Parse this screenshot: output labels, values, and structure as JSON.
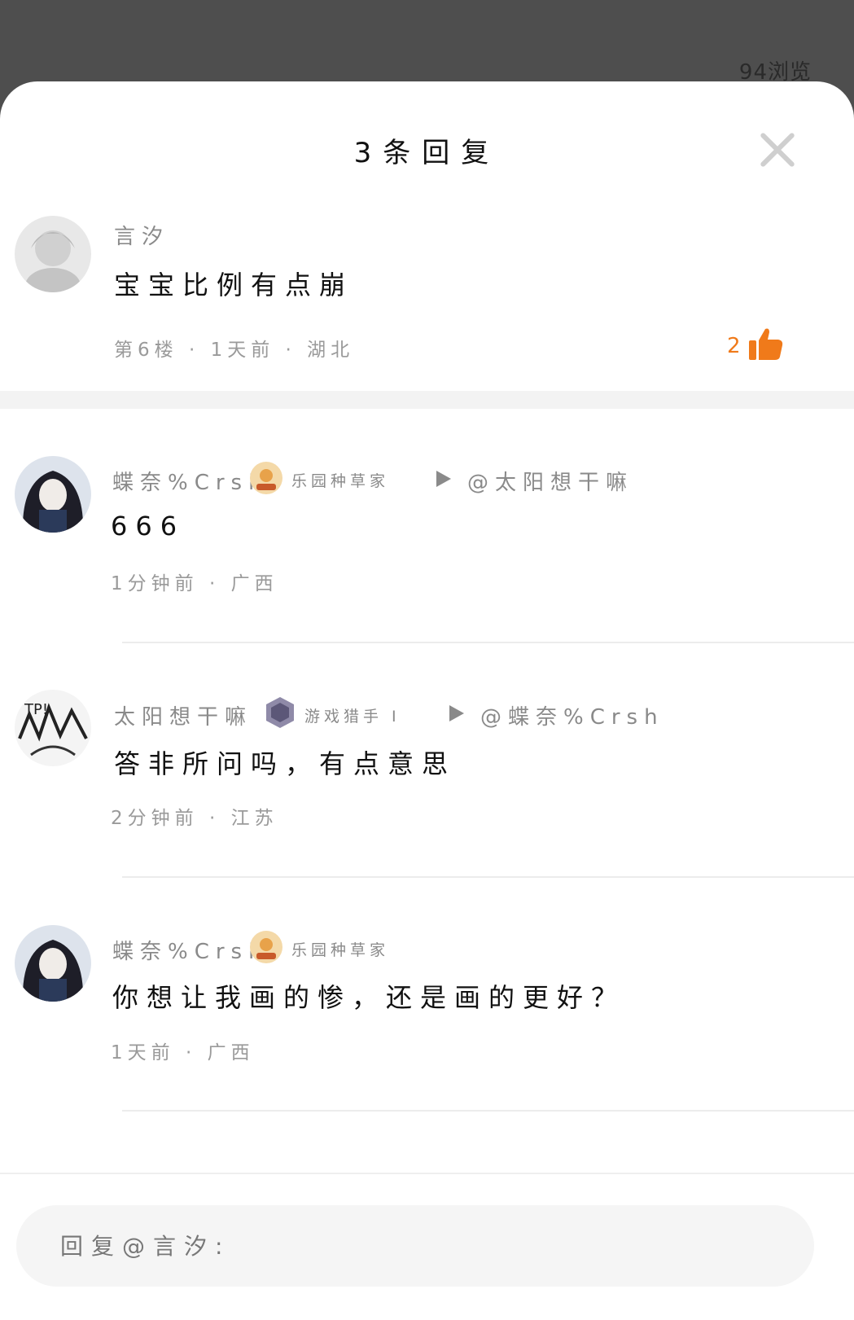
{
  "backdrop": {
    "views_text": "94浏览"
  },
  "sheet": {
    "title": "3条回复"
  },
  "main_comment": {
    "user": "言汐",
    "text": "宝宝比例有点崩",
    "meta": "第6楼 · 1天前 · 湖北",
    "likes": "2",
    "accent_color": "#f07a1a"
  },
  "replies": [
    {
      "user": "蝶奈%Crsh",
      "badge": "乐园种草家",
      "mention": "@太阳想干嘛",
      "text": "666",
      "meta": "1分钟前 · 广西"
    },
    {
      "user": "太阳想干嘛",
      "badge": "游戏猎手 I",
      "mention": "@蝶奈%Crsh",
      "text": "答非所问吗，有点意思",
      "meta": "2分钟前 · 江苏"
    },
    {
      "user": "蝶奈%Crsh",
      "badge": "乐园种草家",
      "text": "你想让我画的惨，还是画的更好？",
      "meta": "1天前 · 广西"
    }
  ],
  "reply_box": {
    "placeholder": "回复@言汐:"
  }
}
